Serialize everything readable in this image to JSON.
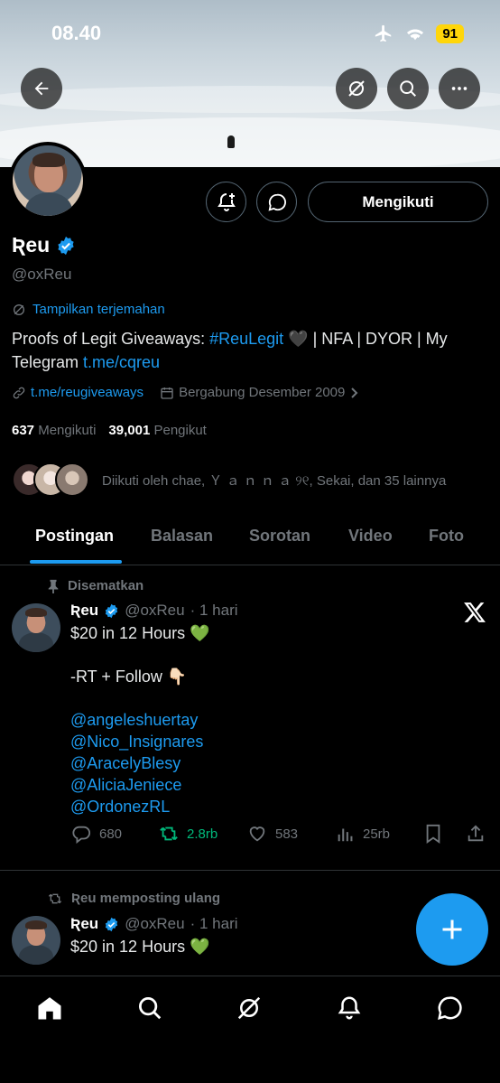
{
  "status_bar": {
    "time": "08.40",
    "battery": "91"
  },
  "profile": {
    "display_name": "Ʀeu",
    "handle": "@oxReu",
    "follow_button": "Mengikuti",
    "translate_link": "Tampilkan terjemahan",
    "bio_prefix": "Proofs of Legit Giveaways: ",
    "bio_hashtag": "#ReuLegit",
    "bio_heart": "🖤",
    "bio_suffix": " | NFA | DYOR | My Telegram ",
    "bio_link": "t.me/cqreu",
    "website": "t.me/reugiveaways",
    "joined": "Bergabung Desember 2009",
    "following_count": "637",
    "following_label": "Mengikuti",
    "followers_count": "39,001",
    "followers_label": "Pengikut",
    "followed_by": "Diikuti oleh chae, Ｙ ａ ｎ ｎ ａ ୨୧, Sekai, dan 35 lainnya"
  },
  "tabs": [
    {
      "label": "Postingan"
    },
    {
      "label": "Balasan"
    },
    {
      "label": "Sorotan"
    },
    {
      "label": "Video"
    },
    {
      "label": "Foto"
    }
  ],
  "pinned_tweet": {
    "pinned_label": "Disematkan",
    "name": "Ʀeu",
    "handle": "@oxReu",
    "time": "· 1 hari",
    "line1": "$20 in 12 Hours 💚",
    "line2": "-RT + Follow 👇🏻",
    "mentions": [
      "@angeleshuertay",
      "@Nico_Insignares",
      "@AracelyBlesy",
      "@AliciaJeniece",
      "@OrdonezRL"
    ],
    "replies": "680",
    "retweets": "2.8rb",
    "likes": "583",
    "views": "25rb"
  },
  "repost_tweet": {
    "repost_label": "Ʀeu memposting ulang",
    "name": "Ʀeu",
    "handle": "@oxReu",
    "time": "· 1 hari",
    "line1": "$20 in 12 Hours 💚"
  },
  "colors": {
    "accent": "#1d9bf0",
    "retweet": "#00ba7c",
    "background": "#000000",
    "muted": "#71767b"
  }
}
